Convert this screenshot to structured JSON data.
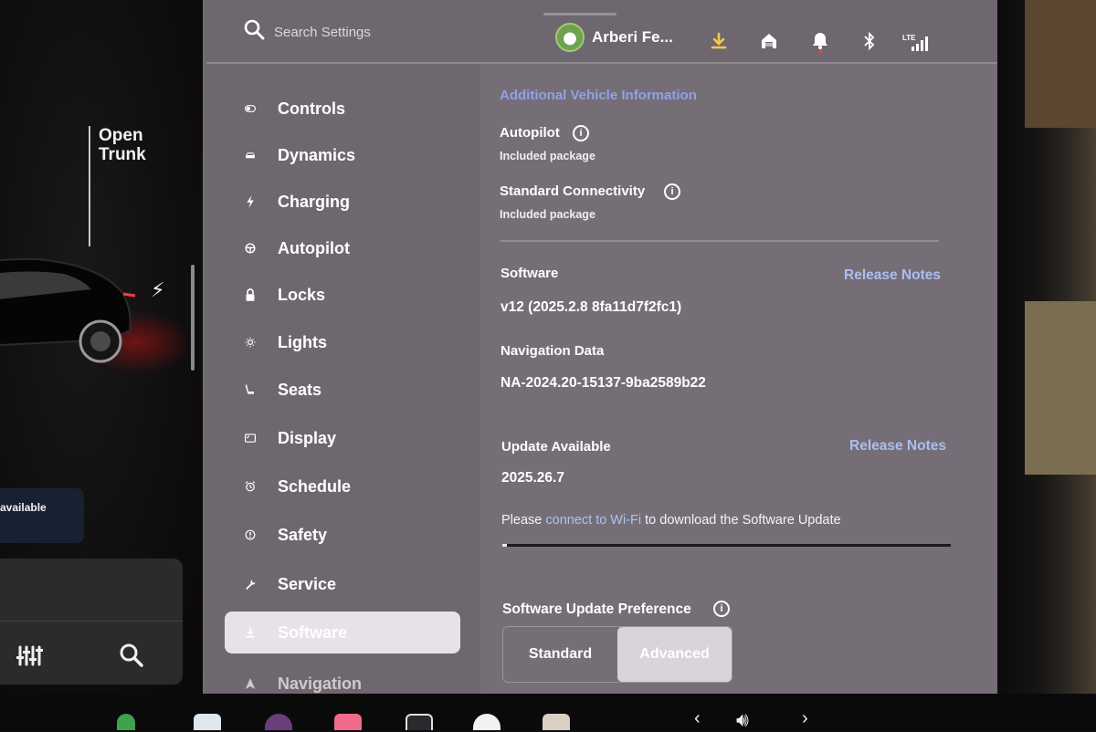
{
  "car_panel": {
    "trunk_label": "Open\nTrunk",
    "available_text": "available",
    "quick_icons": [
      "sliders-icon",
      "search-icon"
    ]
  },
  "topbar": {
    "search_placeholder": "Search Settings",
    "user_name": "Arberi Fe...",
    "icons": [
      "download-icon",
      "home-icon",
      "bell-icon",
      "bluetooth-icon",
      "lte-signal-icon"
    ],
    "lte_label": "LTE",
    "accent_download": "#f2c94c",
    "bell_dot_color": "#e04545"
  },
  "nav": {
    "items": [
      {
        "label": "Controls",
        "icon": "toggle-icon"
      },
      {
        "label": "Dynamics",
        "icon": "car-icon"
      },
      {
        "label": "Charging",
        "icon": "bolt-icon"
      },
      {
        "label": "Autopilot",
        "icon": "steering-wheel-icon"
      },
      {
        "label": "Locks",
        "icon": "lock-icon"
      },
      {
        "label": "Lights",
        "icon": "sun-icon"
      },
      {
        "label": "Seats",
        "icon": "seat-icon"
      },
      {
        "label": "Display",
        "icon": "display-icon"
      },
      {
        "label": "Schedule",
        "icon": "alarm-clock-icon"
      },
      {
        "label": "Safety",
        "icon": "alert-circle-icon"
      },
      {
        "label": "Service",
        "icon": "wrench-icon"
      },
      {
        "label": "Software",
        "icon": "download-icon",
        "active": true
      },
      {
        "label": "Navigation",
        "icon": "navigation-arrow-icon"
      }
    ]
  },
  "main": {
    "additional_info_link": "Additional Vehicle Information",
    "autopilot": {
      "title": "Autopilot",
      "status": "Included package"
    },
    "connectivity": {
      "title": "Standard Connectivity",
      "status": "Included package"
    },
    "software": {
      "title": "Software",
      "release_notes": "Release Notes",
      "version": "v12 (2025.2.8 8fa11d7f2fc1)"
    },
    "navigation_data": {
      "title": "Navigation Data",
      "value": "NA-2024.20-15137-9ba2589b22"
    },
    "update": {
      "title": "Update Available",
      "release_notes": "Release Notes",
      "version": "2025.26.7",
      "note_prefix": "Please ",
      "note_link": "connect to Wi-Fi",
      "note_suffix": " to download the Software Update",
      "progress": 0.01
    },
    "preference": {
      "title": "Software Update Preference",
      "options": [
        "Standard",
        "Advanced"
      ],
      "selected": "Advanced"
    }
  },
  "dock": {
    "icons": [
      "phone-icon",
      "camera-icon",
      "music-icon",
      "app-launcher-icon",
      "assistant-icon",
      "browser-icon",
      "volume-icon"
    ],
    "volume_prev": "‹",
    "volume_next": "›"
  }
}
